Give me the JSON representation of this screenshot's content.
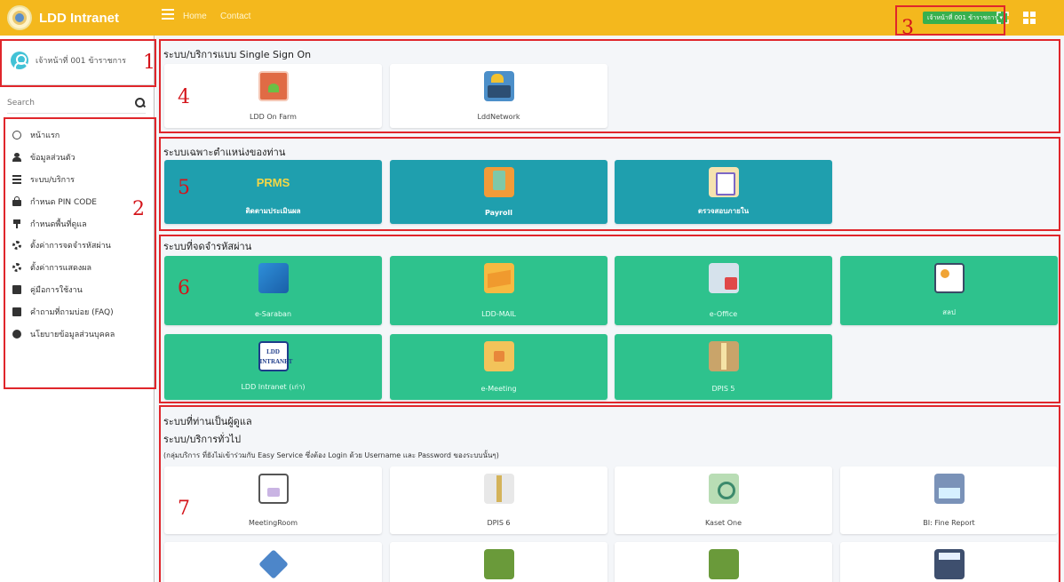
{
  "brand": {
    "title": "LDD Intranet"
  },
  "nav": {
    "home": "Home",
    "contact": "Contact",
    "user_badge": "เจ้าหน้าที่ 001 ข้าราชการ ▾"
  },
  "sidebar": {
    "user_name": "เจ้าหน้าที่ 001 ข้าราชการ",
    "search_placeholder": "Search",
    "items": [
      {
        "label": "หน้าแรก",
        "icon": "circle-icon"
      },
      {
        "label": "ข้อมูลส่วนตัว",
        "icon": "user-icon"
      },
      {
        "label": "ระบบ/บริการ",
        "icon": "list-icon"
      },
      {
        "label": "กำหนด PIN CODE",
        "icon": "lock-icon"
      },
      {
        "label": "กำหนดพื้นที่ดูแล",
        "icon": "pin-icon"
      },
      {
        "label": "ตั้งค่าการจดจำรหัสผ่าน",
        "icon": "gear-icon"
      },
      {
        "label": "ตั้งค่าการแสดงผล",
        "icon": "gear-icon"
      },
      {
        "label": "คู่มือการใช้งาน",
        "icon": "book-icon"
      },
      {
        "label": "คำถามที่ถามบ่อย (FAQ)",
        "icon": "book-icon"
      },
      {
        "label": "นโยบายข้อมูลส่วนบุคคล",
        "icon": "info-icon"
      }
    ]
  },
  "sections": {
    "sso": {
      "title": "ระบบ/บริการแบบ Single Sign On",
      "cards": [
        "LDD On Farm",
        "LddNetwork"
      ]
    },
    "position": {
      "title": "ระบบเฉพาะตำแหน่งของท่าน",
      "cards": [
        "ติดตามประเมินผล",
        "Payroll",
        "ตรวจสอบภายใน"
      ],
      "prms_text": "PRMS"
    },
    "password": {
      "title": "ระบบที่จดจำรหัสผ่าน",
      "cards": [
        "e-Saraban",
        "LDD-MAIL",
        "e-Office",
        "สลป",
        "LDD Intranet (เก่า)",
        "e-Meeting",
        "DPIS 5"
      ],
      "intranet_logo_line1": "LDD",
      "intranet_logo_line2": "INTRANET"
    },
    "managed": {
      "title": "ระบบที่ท่านเป็นผู้ดูแล",
      "general_title": "ระบบ/บริการทั่วไป",
      "note": "(กลุ่มบริการ ที่ยังไม่เข้าร่วมกับ Easy Service ซึ่งต้อง Login ด้วย Username และ Password ของระบบนั้นๆ)",
      "cards": [
        "MeetingRoom",
        "DPIS 6",
        "Kaset One",
        "BI: Fine Report"
      ]
    }
  },
  "annotations": [
    "1",
    "2",
    "3",
    "4",
    "5",
    "6",
    "7"
  ],
  "colors": {
    "topbar": "#f4b81d",
    "teal_card": "#1f9fae",
    "green_card": "#2ec28d",
    "annotation": "#e0262b"
  }
}
